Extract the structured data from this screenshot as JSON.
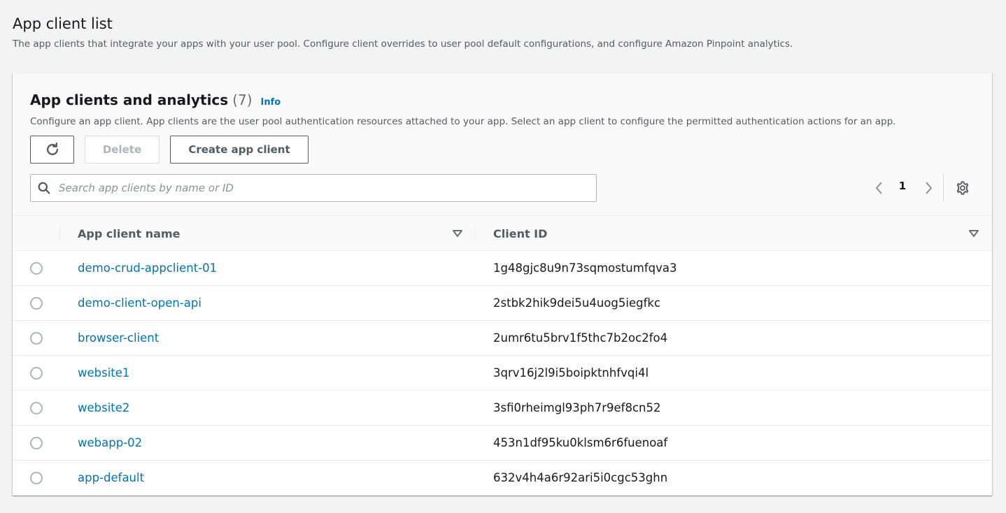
{
  "page": {
    "title": "App client list",
    "description": "The app clients that integrate your apps with your user pool. Configure client overrides to user pool default configurations, and configure Amazon Pinpoint analytics."
  },
  "container": {
    "title": "App clients and analytics",
    "count": "(7)",
    "info_label": "Info",
    "description": "Configure an app client. App clients are the user pool authentication resources attached to your app. Select an app client to configure the permitted authentication actions for an app."
  },
  "toolbar": {
    "refresh_icon": "refresh-icon",
    "delete_label": "Delete",
    "create_label": "Create app client"
  },
  "search": {
    "placeholder": "Search app clients by name or ID",
    "value": ""
  },
  "pagination": {
    "current_page": "1"
  },
  "table": {
    "columns": [
      "App client name",
      "Client ID"
    ],
    "rows": [
      {
        "name": "demo-crud-appclient-01",
        "client_id": "1g48gjc8u9n73sqmostumfqva3"
      },
      {
        "name": "demo-client-open-api",
        "client_id": "2stbk2hik9dei5u4uog5iegfkc"
      },
      {
        "name": "browser-client",
        "client_id": "2umr6tu5brv1f5thc7b2oc2fo4"
      },
      {
        "name": "website1",
        "client_id": "3qrv16j2l9i5boipktnhfvqi4l"
      },
      {
        "name": "website2",
        "client_id": "3sfi0rheimgl93ph7r9ef8cn52"
      },
      {
        "name": "webapp-02",
        "client_id": "453n1df95ku0klsm6r6fuenoaf"
      },
      {
        "name": "app-default",
        "client_id": "632v4h4a6r92ari5i0cgc53ghn"
      }
    ]
  },
  "colors": {
    "link": "#0073bb",
    "text": "#16191f",
    "muted": "#545b64",
    "background": "#f2f3f3"
  }
}
